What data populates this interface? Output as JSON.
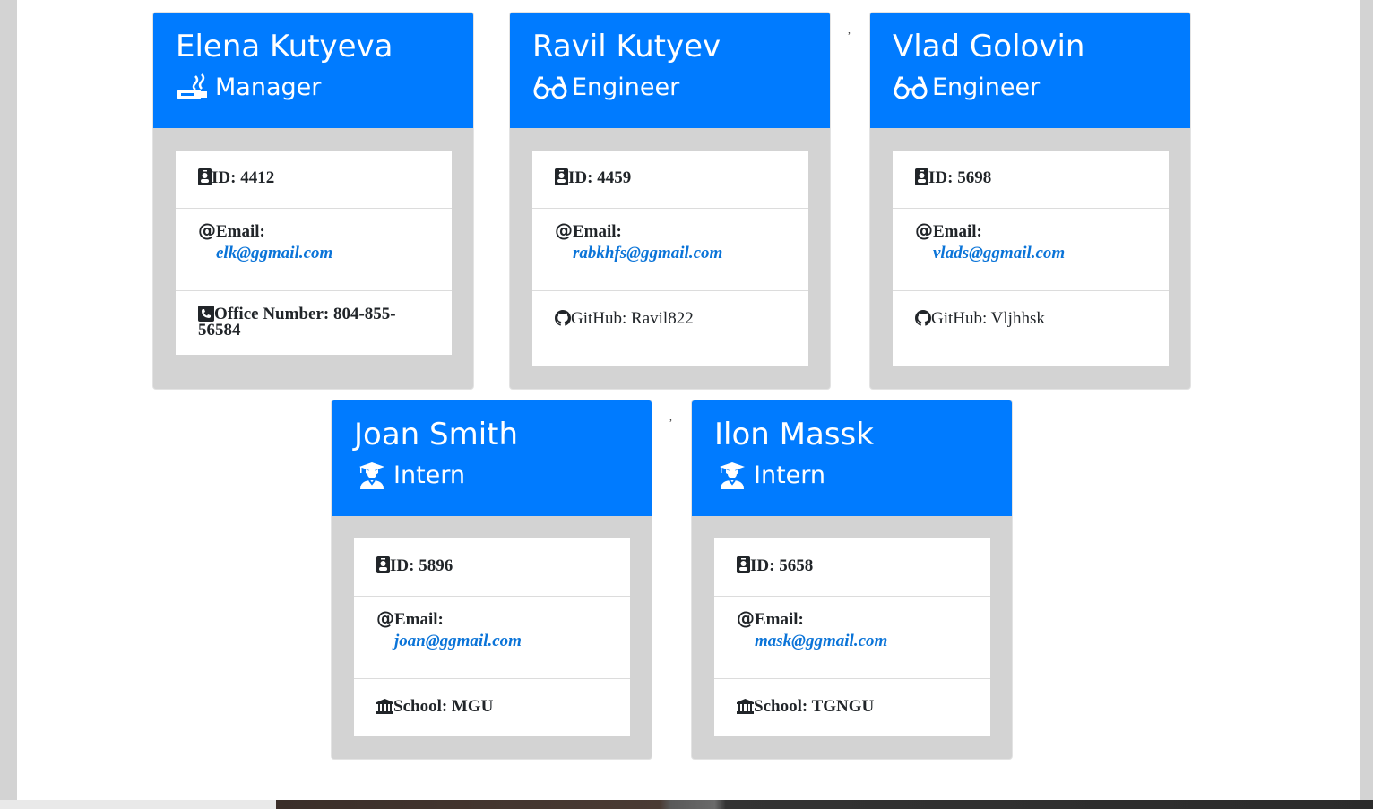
{
  "cards": [
    {
      "name": "Elena Kutyeva",
      "role": "Manager",
      "role_icon": "mug-icon",
      "id_text": "ID: 4412",
      "email_label": "Email:",
      "email": "elk@ggmail.com",
      "extra_text": "Office Number: 804-855-56584",
      "extra_icon": "phone-icon"
    },
    {
      "name": "Ravil Kutyev",
      "role": "Engineer",
      "role_icon": "glasses-icon",
      "id_text": "ID: 4459",
      "email_label": "Email:",
      "email": "rabkhfs@ggmail.com",
      "extra_text": "GitHub: Ravil822",
      "extra_icon": "github-icon"
    },
    {
      "name": "Vlad Golovin",
      "role": "Engineer",
      "role_icon": "glasses-icon",
      "id_text": "ID: 5698",
      "email_label": "Email:",
      "email": "vlads@ggmail.com",
      "extra_text": "GitHub: Vljhhsk",
      "extra_icon": "github-icon"
    },
    {
      "name": "Joan Smith",
      "role": "Intern",
      "role_icon": "graduate-icon",
      "id_text": "ID: 5896",
      "email_label": "Email:",
      "email": "joan@ggmail.com",
      "extra_text": "School: MGU",
      "extra_icon": "university-icon"
    },
    {
      "name": "Ilon Massk",
      "role": "Intern",
      "role_icon": "graduate-icon",
      "id_text": "ID: 5658",
      "email_label": "Email:",
      "email": "mask@ggmail.com",
      "extra_text": "School: TGNGU",
      "extra_icon": "university-icon"
    }
  ],
  "stray_marks": [
    ",",
    ","
  ],
  "colors": {
    "header": "#007bff",
    "card_bg": "#d3d3d3",
    "link": "#0b74d8"
  }
}
